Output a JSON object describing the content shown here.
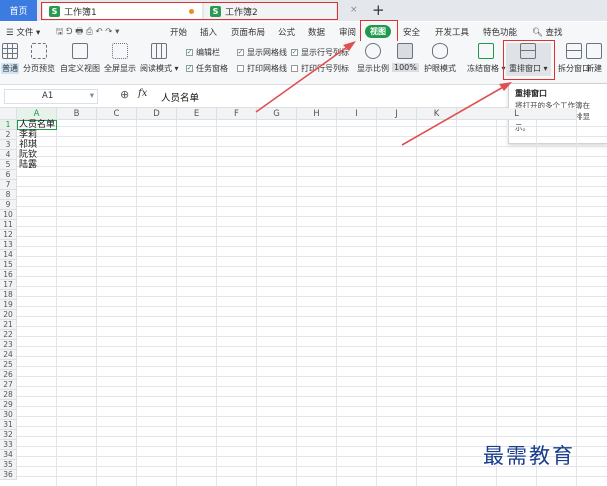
{
  "tabs": {
    "home": "首页",
    "doc1": "工作簿1",
    "doc2": "工作簿2",
    "tab_s": "S",
    "close": "×",
    "new": "+"
  },
  "menu": {
    "file": "文件",
    "items": [
      "开始",
      "插入",
      "页面布局",
      "公式",
      "数据",
      "审阅",
      "视图",
      "安全",
      "开发工具",
      "特色功能"
    ],
    "search": "查找"
  },
  "ribbon": {
    "normal": "普通",
    "page_break": "分页预览",
    "custom_view": "自定义视图",
    "full_screen": "全屏显示",
    "reading_mode": "阅读模式",
    "edit_bar": "编辑栏",
    "task_pane": "任务窗格",
    "show_grid": "显示网格线",
    "print_grid": "打印网格线",
    "show_row_col": "显示行号列标",
    "print_row_col": "打印行号列标",
    "zoom": "显示比例",
    "zoom_100": "100%",
    "eye_mode": "护眼模式",
    "freeze": "冻结窗格",
    "arrange": "重排窗口",
    "split": "拆分窗口",
    "new_window": "新建"
  },
  "tooltip": {
    "title": "重排窗口",
    "line1": "将打开的多个工作簿在",
    "line2": "一个程序窗口下并排显",
    "line3": "示。"
  },
  "formula_bar": {
    "cell_ref": "A1",
    "fx": "fx",
    "content": "人员名单"
  },
  "grid": {
    "columns": [
      "A",
      "B",
      "C",
      "D",
      "E",
      "F",
      "G",
      "H",
      "I",
      "J",
      "K",
      "L"
    ],
    "rows": [
      "1",
      "2",
      "3",
      "4",
      "5",
      "6",
      "7",
      "8",
      "9",
      "10",
      "11",
      "12",
      "13",
      "14",
      "15",
      "16",
      "17",
      "18",
      "19",
      "20",
      "21",
      "22",
      "23",
      "24",
      "25",
      "26",
      "27",
      "28",
      "29",
      "30",
      "31",
      "32",
      "33",
      "34",
      "35",
      "36"
    ],
    "cells": [
      "人员名单",
      "李莉",
      "祁琪",
      "阮钦",
      "陆露"
    ]
  },
  "watermark": "最需教育",
  "colors": {
    "accent_green": "#1f9a4c",
    "home_blue": "#3c7ce0",
    "highlight_red": "#e03030",
    "arrow_red": "#e05050"
  }
}
